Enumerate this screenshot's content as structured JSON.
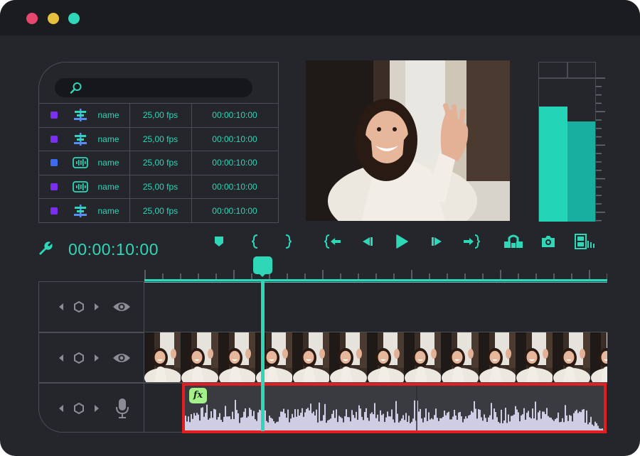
{
  "colors": {
    "accent": "#2fd6b8",
    "panel_border": "#4a4d55",
    "window_bg": "#24262b",
    "titlebar_bg": "#1b1c20",
    "dot_red": "#e8466f",
    "dot_yellow": "#e6c03d",
    "dot_green": "#2fd6b8",
    "highlight_box": "#e41e1e",
    "fx_badge": "#a4f08a",
    "waveform": "#cfcde4"
  },
  "library": {
    "search": {
      "icon": "search-icon",
      "placeholder": ""
    },
    "rows": [
      {
        "color": "#7b2ff0",
        "type_icon": "video-track-icon",
        "name": "name",
        "fps": "25,00 fps",
        "duration": "00:00:10:00"
      },
      {
        "color": "#7b2ff0",
        "type_icon": "video-track-icon",
        "name": "name",
        "fps": "25,00 fps",
        "duration": "00:00:10:00"
      },
      {
        "color": "#3d6bf0",
        "type_icon": "audio-track-icon",
        "name": "name",
        "fps": "25,00 fps",
        "duration": "00:00:10:00"
      },
      {
        "color": "#7b2ff0",
        "type_icon": "audio-track-icon",
        "name": "name",
        "fps": "25,00 fps",
        "duration": "00:00:10:00"
      },
      {
        "color": "#7b2ff0",
        "type_icon": "video-track-icon",
        "name": "name",
        "fps": "25,00 fps",
        "duration": "00:00:10:00"
      }
    ]
  },
  "meter": {
    "left_level": 0.8,
    "right_level": 0.7
  },
  "transport": {
    "timecode": "00:00:10:00",
    "buttons": [
      "marker-icon",
      "mark-in-icon",
      "mark-out-icon",
      "go-to-in-icon",
      "step-back-icon",
      "play-icon",
      "step-forward-icon",
      "go-to-out-icon",
      "lift-icon",
      "snapshot-icon",
      "filmstrip-icon"
    ]
  },
  "timeline": {
    "playhead_position": 0.25,
    "tracks": [
      {
        "kind": "video",
        "visibility_icon": "eye-icon"
      },
      {
        "kind": "video",
        "visibility_icon": "eye-icon"
      },
      {
        "kind": "audio",
        "visibility_icon": "microphone-icon"
      }
    ],
    "audio_clip": {
      "effect_label": "fx"
    }
  }
}
